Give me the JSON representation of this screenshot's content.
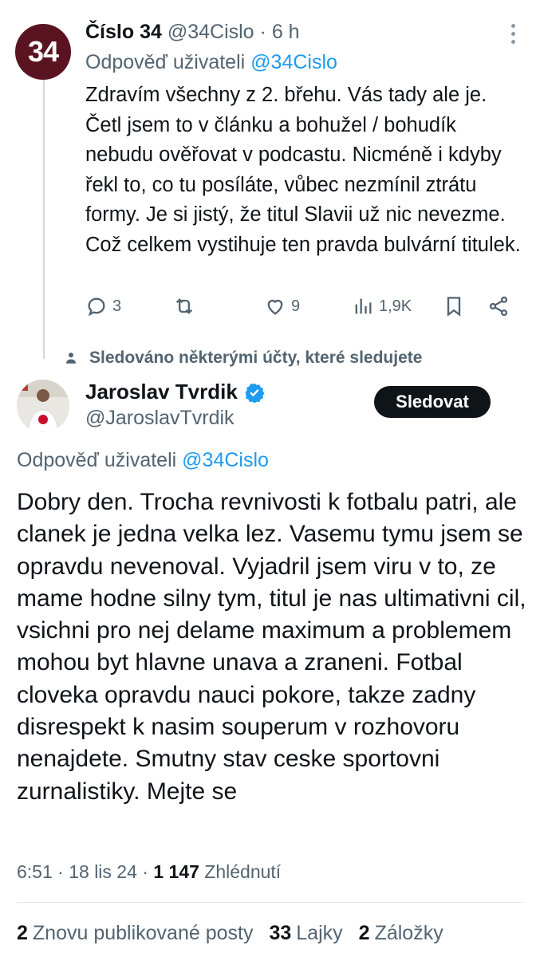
{
  "reply_tweet": {
    "avatar_text": "34",
    "display_name": "Číslo 34",
    "handle": "@34Cislo",
    "separator": "·",
    "time": "6 h",
    "reply_prefix": "Odpověď uživateli",
    "reply_to": "@34Cislo",
    "text": "Zdravím všechny z 2. břehu. Vás tady ale je. Četl jsem to v článku a bohužel / bohudík nebudu ověřovat v podcastu. Nicméně i kdyby řekl to, co tu posíláte, vůbec nezmínil ztrátu formy. Je si jistý, že titul Slavii už nic nevezme. Což celkem vystihuje ten pravda bulvární titulek.",
    "replies": "3",
    "reposts": "",
    "likes": "9",
    "views": "1,9K"
  },
  "social_context": "Sledováno některými účty, které sledujete",
  "main_tweet": {
    "display_name": "Jaroslav Tvrdik",
    "handle": "@JaroslavTvrdik",
    "follow_label": "Sledovat",
    "reply_prefix": "Odpověď uživateli",
    "reply_to": "@34Cislo",
    "text": "Dobry den. Trocha revnivosti k fotbalu patri, ale clanek je jedna velka lez. Vasemu tymu jsem se opravdu nevenoval. Vyjadril jsem viru v to, ze mame hodne silny tym, titul je nas ultimativni cil, vsichni pro nej delame maximum a problemem mohou byt hlavne unava a zraneni. Fotbal cloveka opravdu nauci pokore, takze zadny disrespekt k nasim souperum v rozhovoru nenajdete. Smutny stav ceske sportovni zurnalistiky. Mejte se",
    "time": "6:51",
    "date": "18 lis 24",
    "sep": "·",
    "views_count": "1 147",
    "views_label": "Zhlédnutí",
    "reposts_count": "2",
    "reposts_label": "Znovu publikované posty",
    "likes_count": "33",
    "likes_label": "Lajky",
    "bookmarks_count": "2",
    "bookmarks_label": "Záložky"
  },
  "colors": {
    "accent": "#1d9bf0",
    "muted": "#536471",
    "text": "#0f1419",
    "avatar_34_bg": "#5a1421",
    "verified": "#1d9bf0"
  },
  "icons": [
    "more-icon",
    "reply-icon",
    "repost-icon",
    "like-icon",
    "views-icon",
    "bookmark-icon",
    "share-icon",
    "person-icon",
    "verified-icon"
  ]
}
